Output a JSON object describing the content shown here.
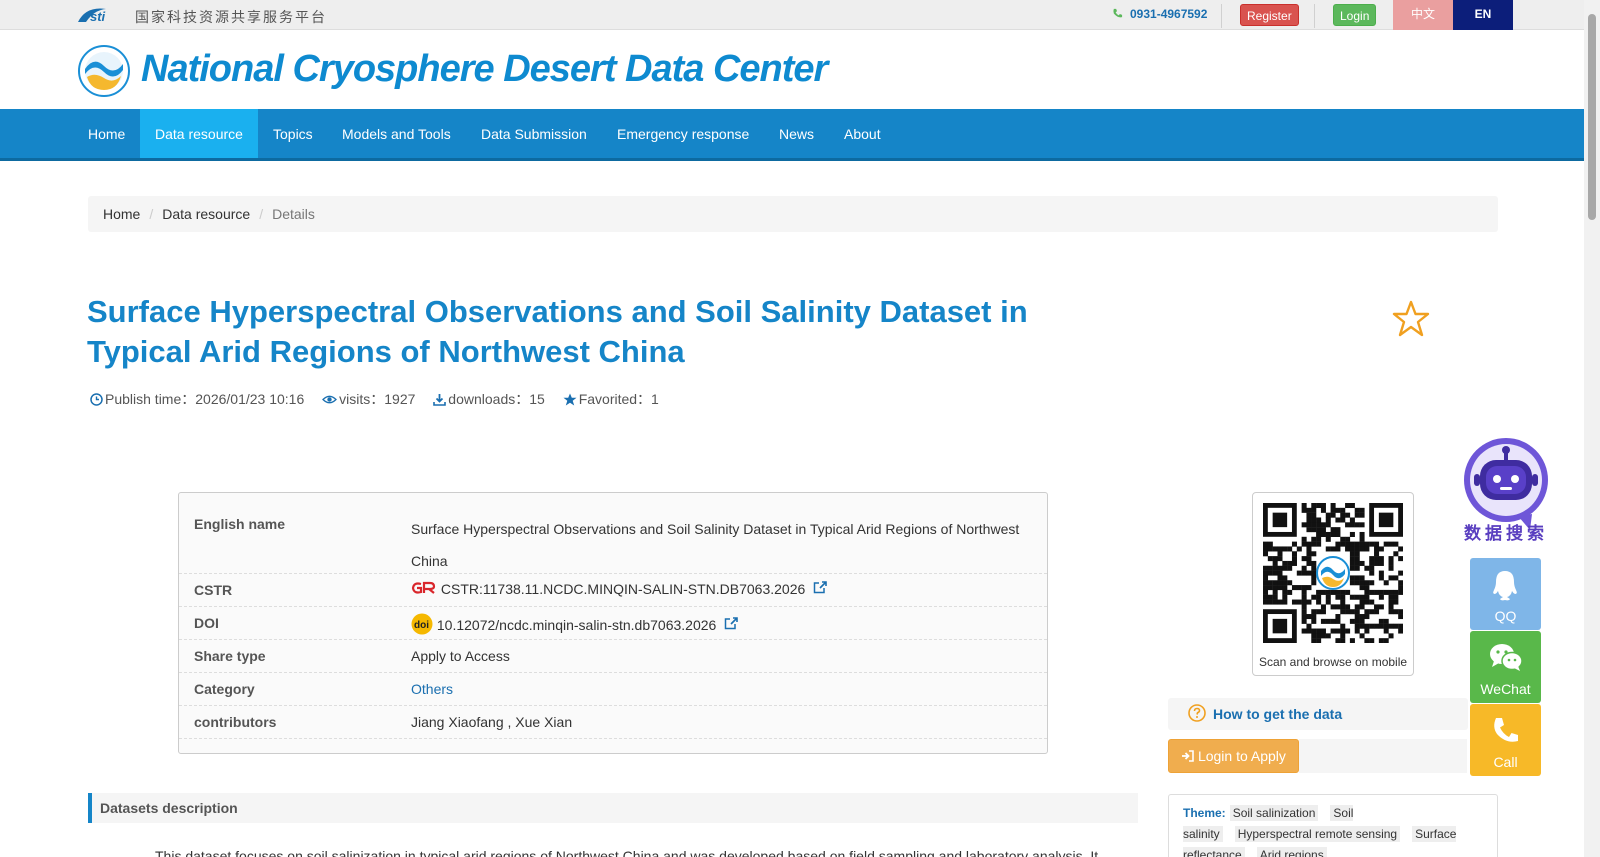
{
  "topbar": {
    "platform_name": "国家科技资源共享服务平台",
    "logo_text": "Nsti",
    "phone": "0931-4967592",
    "register_label": "Register",
    "login_label": "Login",
    "lang_cn": "中文",
    "lang_en": "EN"
  },
  "header": {
    "site_title": "National Cryosphere Desert Data Center"
  },
  "nav": {
    "items": [
      "Home",
      "Data resource",
      "Topics",
      "Models and Tools",
      "Data Submission",
      "Emergency response",
      "News",
      "About"
    ],
    "active_index": 1
  },
  "breadcrumb": {
    "home": "Home",
    "section": "Data resource",
    "current": "Details",
    "separator": "/"
  },
  "dataset": {
    "title": "Surface Hyperspectral Observations and Soil Salinity Dataset in Typical Arid Regions of Northwest China",
    "publish_time": "Publish time：2026/01/23 10:16",
    "visits": "visits：1927",
    "downloads": "downloads：15",
    "favorited": "Favorited：1"
  },
  "info": {
    "english_name_label": "English name",
    "english_name": "Surface Hyperspectral Observations and Soil Salinity Dataset in Typical Arid Regions of Northwest China",
    "cstr_label": "CSTR",
    "cstr": "CSTR:11738.11.NCDC.MINQIN-SALIN-STN.DB7063.2026",
    "doi_label": "DOI",
    "doi": "10.12072/ncdc.minqin-salin-stn.db7063.2026",
    "share_type_label": "Share type",
    "share_type": "Apply to Access",
    "category_label": "Category",
    "category": "Others",
    "contributors_label": "contributors",
    "contributors": "Jiang Xiaofang , Xue Xian"
  },
  "sidebar": {
    "qr_caption": "Scan and browse on mobile",
    "howto_label": "How to get the data",
    "apply_label": "Login to Apply",
    "theme_label": "Theme:",
    "theme_tags": [
      "Soil salinization",
      "Soil salinity",
      "Hyperspectral remote sensing",
      "Surface reflectance",
      "Arid regions"
    ]
  },
  "description": {
    "heading": "Datasets description",
    "text": "This dataset focuses on soil salinization in typical arid regions of Northwest China and was developed based on field sampling and laboratory analysis. It"
  },
  "float": {
    "robot_text": "数据搜索",
    "qq_label": "QQ",
    "wechat_label": "WeChat",
    "call_label": "Call"
  },
  "colors": {
    "brand_blue": "#1585c8",
    "nav_active": "#1ab0ef",
    "star": "#f0a020"
  }
}
